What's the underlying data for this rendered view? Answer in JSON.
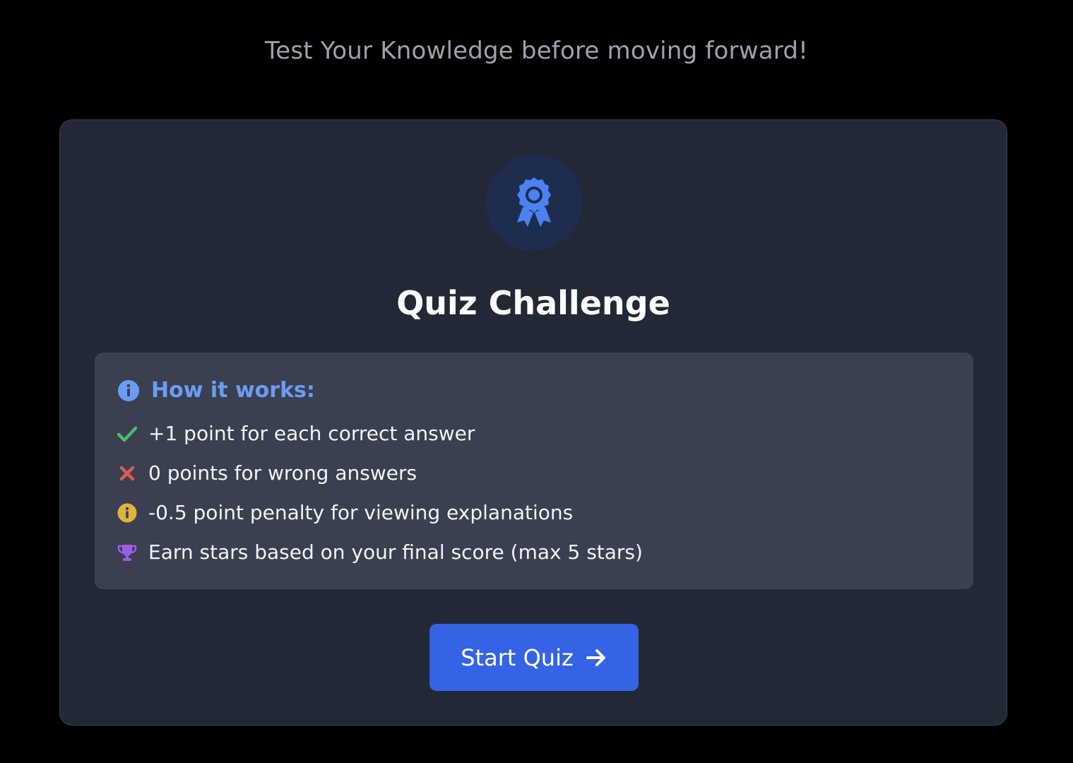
{
  "header": {
    "subtitle": "Test Your Knowledge before moving forward!"
  },
  "card": {
    "badge_icon": "award-ribbon-icon",
    "title": "Quiz Challenge",
    "info": {
      "heading_icon": "info-circle-icon",
      "heading": "How it works:",
      "rules": [
        {
          "icon": "check-icon",
          "color": "#4cbb6c",
          "text": "+1 point for each correct answer"
        },
        {
          "icon": "x-mark-icon",
          "color": "#e05a4f",
          "text": "0 points for wrong answers"
        },
        {
          "icon": "info-circle-icon",
          "color": "#e0b43c",
          "text": "-0.5 point penalty for viewing explanations"
        },
        {
          "icon": "trophy-icon",
          "color": "#9b5de5",
          "text": "Earn stars based on your final score (max 5 stars)"
        }
      ]
    },
    "start_button": {
      "label": "Start Quiz",
      "icon": "arrow-right-icon"
    }
  },
  "colors": {
    "accent": "#3563e5",
    "background": "#000000",
    "card": "#222836",
    "info_heading": "#6b9cf5"
  }
}
